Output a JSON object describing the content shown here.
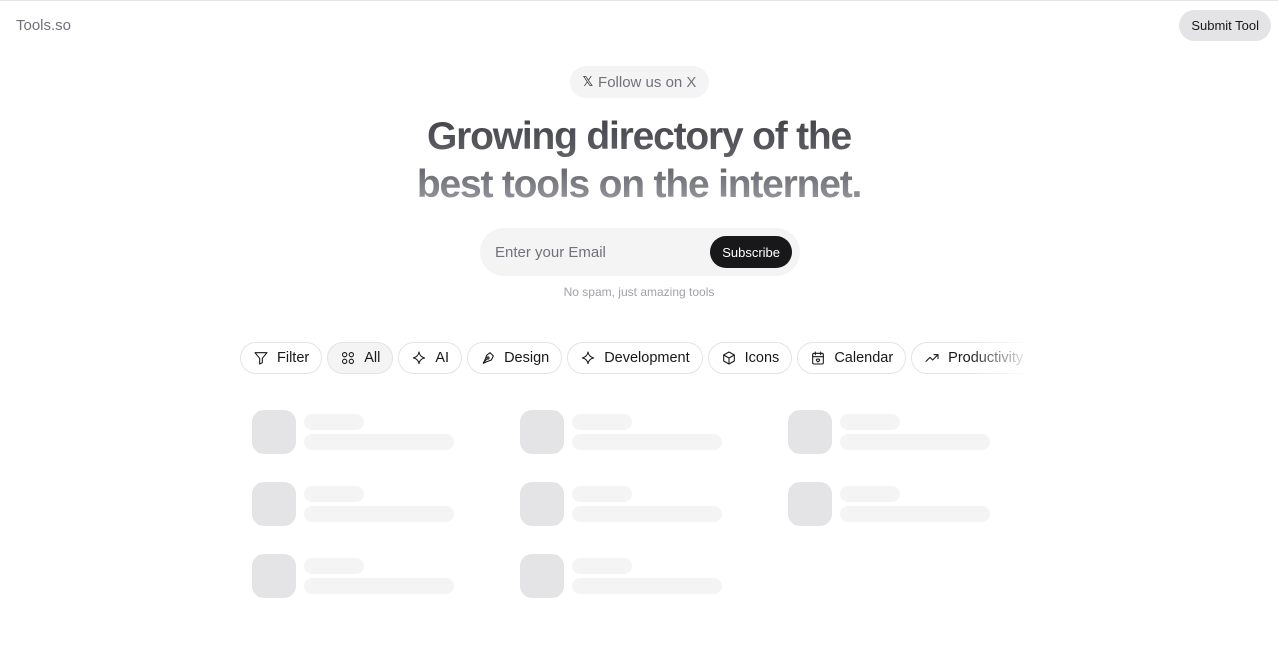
{
  "header": {
    "logo": "Tools.so",
    "submit_label": "Submit Tool"
  },
  "follow": {
    "icon": "x-logo-icon",
    "icon_glyph": "𝕏",
    "label": "Follow us on X"
  },
  "hero": {
    "line1": "Growing directory of the",
    "line2": "best tools on the internet."
  },
  "subscribe": {
    "placeholder": "Enter your Email",
    "value": "",
    "button_label": "Subscribe",
    "note": "No spam, just amazing tools"
  },
  "filters": [
    {
      "label": "Filter",
      "icon": "filter-icon",
      "active": false
    },
    {
      "label": "All",
      "icon": "grid-icon",
      "active": true
    },
    {
      "label": "AI",
      "icon": "sparkle-icon",
      "active": false
    },
    {
      "label": "Design",
      "icon": "pen-tool-icon",
      "active": false
    },
    {
      "label": "Development",
      "icon": "sparkle-icon",
      "active": false
    },
    {
      "label": "Icons",
      "icon": "box-icon",
      "active": false
    },
    {
      "label": "Calendar",
      "icon": "calendar-heart-icon",
      "active": false
    },
    {
      "label": "Productivity",
      "icon": "trending-up-icon",
      "active": false
    }
  ],
  "skeleton_cards": 8
}
